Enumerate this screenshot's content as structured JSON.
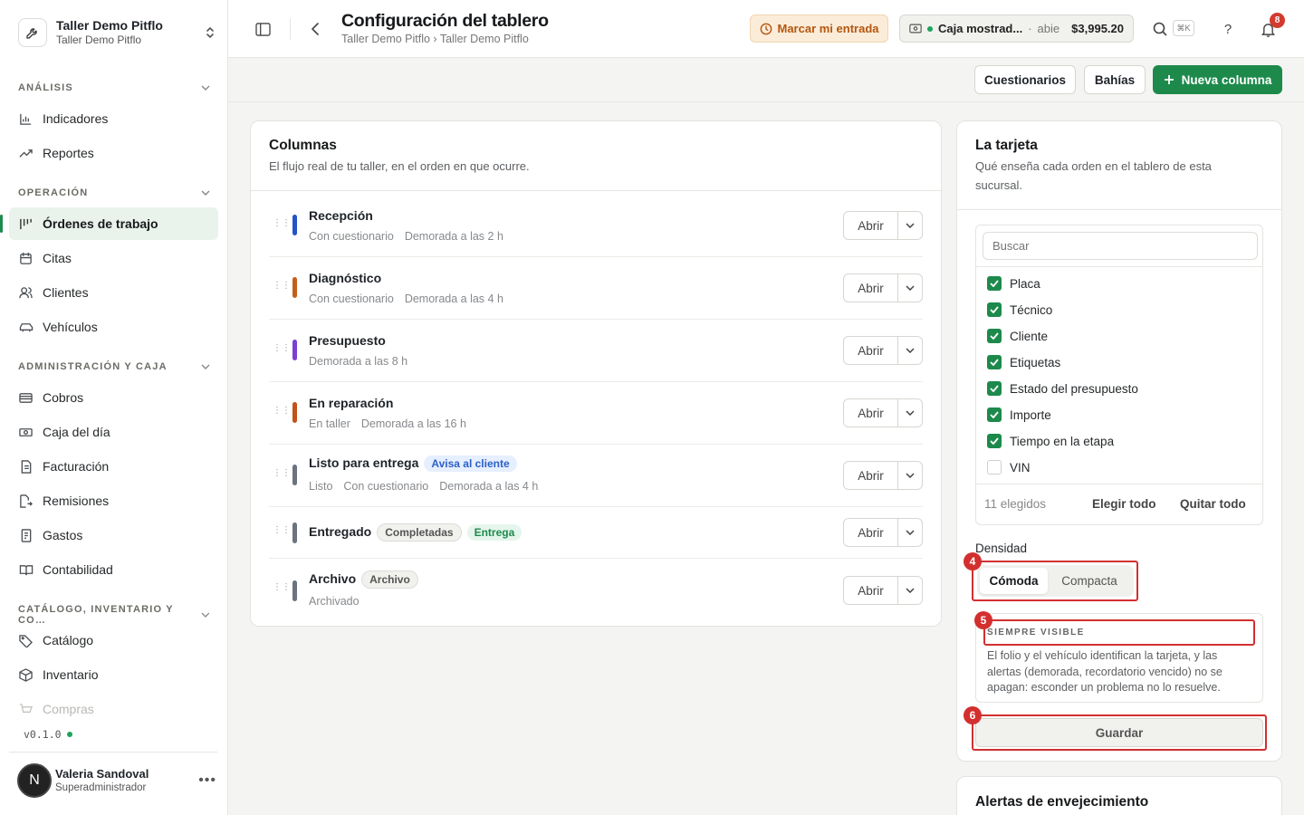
{
  "workspace": {
    "name": "Taller Demo Pitflo",
    "subtitle": "Taller Demo Pitflo"
  },
  "sidebar": {
    "sections": [
      {
        "label": "ANÁLISIS"
      },
      {
        "label": "OPERACIÓN"
      },
      {
        "label": "ADMINISTRACIÓN Y CAJA"
      },
      {
        "label": "CATÁLOGO, INVENTARIO Y CO…"
      }
    ],
    "items": [
      {
        "label": "Indicadores",
        "icon": "bar-chart-icon"
      },
      {
        "label": "Reportes",
        "icon": "trending-icon"
      },
      {
        "label": "Órdenes de trabajo",
        "icon": "kanban-icon",
        "active": true
      },
      {
        "label": "Citas",
        "icon": "calendar-icon"
      },
      {
        "label": "Clientes",
        "icon": "users-icon"
      },
      {
        "label": "Vehículos",
        "icon": "car-icon"
      },
      {
        "label": "Cobros",
        "icon": "wallet-icon"
      },
      {
        "label": "Caja del día",
        "icon": "cash-icon"
      },
      {
        "label": "Facturación",
        "icon": "invoice-icon"
      },
      {
        "label": "Remisiones",
        "icon": "file-arrow-icon"
      },
      {
        "label": "Gastos",
        "icon": "receipt-icon"
      },
      {
        "label": "Contabilidad",
        "icon": "book-icon"
      },
      {
        "label": "Catálogo",
        "icon": "tag-icon"
      },
      {
        "label": "Inventario",
        "icon": "box-icon"
      },
      {
        "label": "Compras",
        "icon": "cart-icon"
      }
    ],
    "version": "v0.1.0"
  },
  "user": {
    "initial": "N",
    "name": "Valeria Sandoval",
    "role": "Superadministrador",
    "more": "•••"
  },
  "header": {
    "title": "Configuración del tablero",
    "breadcrumb": "Taller Demo Pitflo › Taller Demo Pitflo",
    "clock_in": "Marcar mi entrada",
    "cashbox": {
      "name": "Caja mostrad...",
      "sep": "·",
      "status": "abie",
      "amount": "$3,995.20"
    },
    "shortcut": "⌘K",
    "help": "?",
    "notifications": "8"
  },
  "toolbar": {
    "questionnaires": "Cuestionarios",
    "bays": "Bahías",
    "new_column": "Nueva columna"
  },
  "columns_card": {
    "title": "Columnas",
    "description": "El flujo real de tu taller, en el orden en que ocurre.",
    "open_label": "Abrir",
    "rows": [
      {
        "name": "Recepción",
        "color": "#2453c9",
        "meta": [
          "Con cuestionario",
          "Demorada a las 2 h"
        ],
        "pills": []
      },
      {
        "name": "Diagnóstico",
        "color": "#c2601a",
        "meta": [
          "Con cuestionario",
          "Demorada a las 4 h"
        ],
        "pills": []
      },
      {
        "name": "Presupuesto",
        "color": "#7a3fd6",
        "meta": [
          "Demorada a las 8 h"
        ],
        "pills": []
      },
      {
        "name": "En reparación",
        "color": "#c2521a",
        "meta": [
          "En taller",
          "Demorada a las 16 h"
        ],
        "pills": []
      },
      {
        "name": "Listo para entrega",
        "color": "#6b7280",
        "meta": [
          "Listo",
          "Con cuestionario",
          "Demorada a las 4 h"
        ],
        "pills": [
          {
            "text": "Avisa al cliente",
            "style": "blue"
          }
        ]
      },
      {
        "name": "Entregado",
        "color": "#6b7280",
        "meta": [],
        "pills": [
          {
            "text": "Completadas",
            "style": "gray"
          },
          {
            "text": "Entrega",
            "style": "green"
          }
        ]
      },
      {
        "name": "Archivo",
        "color": "#6b7280",
        "meta": [
          "Archivado"
        ],
        "pills": [
          {
            "text": "Archivo",
            "style": "gray"
          }
        ]
      }
    ]
  },
  "card_panel": {
    "title": "La tarjeta",
    "description": "Qué enseña cada orden en el tablero de esta sucursal.",
    "search_placeholder": "Buscar",
    "fields": [
      {
        "label": "Placa",
        "checked": true
      },
      {
        "label": "Técnico",
        "checked": true
      },
      {
        "label": "Cliente",
        "checked": true
      },
      {
        "label": "Etiquetas",
        "checked": true
      },
      {
        "label": "Estado del presupuesto",
        "checked": true
      },
      {
        "label": "Importe",
        "checked": true
      },
      {
        "label": "Tiempo en la etapa",
        "checked": true
      },
      {
        "label": "VIN",
        "checked": false
      }
    ],
    "selected_count": "11 elegidos",
    "select_all": "Elegir todo",
    "clear_all": "Quitar todo",
    "density_label": "Densidad",
    "density_options": [
      "Cómoda",
      "Compacta"
    ],
    "always_visible_title": "SIEMPRE VISIBLE",
    "always_visible_text": "El folio y el vehículo identifican la tarjeta, y las alertas (demorada, recordatorio vencido) no se apagan: esconder un problema no lo resuelve.",
    "save": "Guardar"
  },
  "aging_card": {
    "title": "Alertas de envejecimiento"
  },
  "annotations": [
    "4",
    "5",
    "6"
  ],
  "colors": {
    "accent": "#1d8a4c",
    "highlight": "#d32f2f",
    "clock_in_text": "#b5560f"
  }
}
